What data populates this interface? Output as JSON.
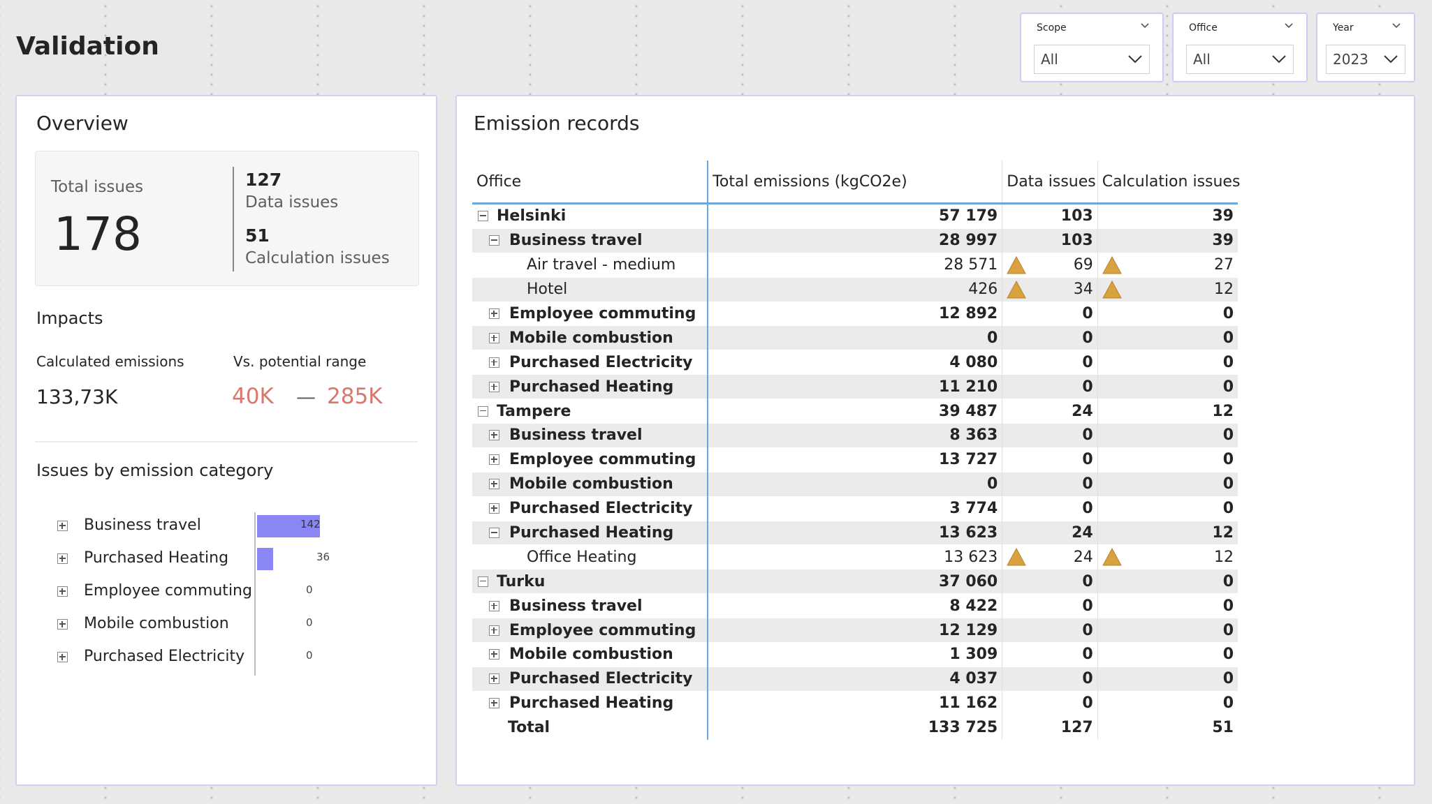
{
  "page": {
    "title": "Validation"
  },
  "slicers": [
    {
      "label": "Scope",
      "value": "All"
    },
    {
      "label": "Office",
      "value": "All"
    },
    {
      "label": "Year",
      "value": "2023"
    }
  ],
  "overview": {
    "title": "Overview",
    "total_issues_label": "Total issues",
    "total_issues": "178",
    "data_issues_value": "127",
    "data_issues_label": "Data issues",
    "calc_issues_value": "51",
    "calc_issues_label": "Calculation issues",
    "impacts_title": "Impacts",
    "calc_emissions_label": "Calculated emissions",
    "calc_emissions_value": "133,73K",
    "range_label": "Vs. potential range",
    "range_low": "40K",
    "range_dash": "—",
    "range_high": "285K",
    "issues_title": "Issues by emission category",
    "bar_color": "#8a87f5",
    "range_color": "#d9776d"
  },
  "chart_data": {
    "type": "bar",
    "orientation": "horizontal",
    "categories": [
      "Business travel",
      "Purchased Heating",
      "Employee commuting",
      "Mobile combustion",
      "Purchased Electricity"
    ],
    "values": [
      142,
      36,
      0,
      0,
      0
    ],
    "value_labels": [
      "142",
      "36",
      "0",
      "0",
      "0"
    ],
    "title": "Issues by emission category",
    "xlim": [
      0,
      142
    ]
  },
  "records": {
    "title": "Emission records",
    "columns": {
      "office": "Office",
      "emissions": "Total emissions (kgCO2e)",
      "data": "Data issues",
      "calc": "Calculation issues"
    },
    "warn_color": "#d9a13f",
    "rows": [
      {
        "level": 0,
        "expander": "minus",
        "name": "Helsinki",
        "emissions": "57 179",
        "data": "103",
        "calc": "39",
        "warn": false,
        "bold": true,
        "zebra": false
      },
      {
        "level": 1,
        "expander": "minus",
        "name": "Business travel",
        "emissions": "28 997",
        "data": "103",
        "calc": "39",
        "warn": false,
        "bold": true,
        "zebra": true
      },
      {
        "level": 2,
        "expander": "",
        "name": "Air travel - medium",
        "emissions": "28 571",
        "data": "69",
        "calc": "27",
        "warn": true,
        "bold": false,
        "zebra": false
      },
      {
        "level": 2,
        "expander": "",
        "name": "Hotel",
        "emissions": "426",
        "data": "34",
        "calc": "12",
        "warn": true,
        "bold": false,
        "zebra": true
      },
      {
        "level": 1,
        "expander": "plus",
        "name": "Employee commuting",
        "emissions": "12 892",
        "data": "0",
        "calc": "0",
        "warn": false,
        "bold": true,
        "zebra": false
      },
      {
        "level": 1,
        "expander": "plus",
        "name": "Mobile combustion",
        "emissions": "0",
        "data": "0",
        "calc": "0",
        "warn": false,
        "bold": true,
        "zebra": true
      },
      {
        "level": 1,
        "expander": "plus",
        "name": "Purchased Electricity",
        "emissions": "4 080",
        "data": "0",
        "calc": "0",
        "warn": false,
        "bold": true,
        "zebra": false
      },
      {
        "level": 1,
        "expander": "plus",
        "name": "Purchased Heating",
        "emissions": "11 210",
        "data": "0",
        "calc": "0",
        "warn": false,
        "bold": true,
        "zebra": true
      },
      {
        "level": 0,
        "expander": "minus",
        "name": "Tampere",
        "emissions": "39 487",
        "data": "24",
        "calc": "12",
        "warn": false,
        "bold": true,
        "zebra": false
      },
      {
        "level": 1,
        "expander": "plus",
        "name": "Business travel",
        "emissions": "8 363",
        "data": "0",
        "calc": "0",
        "warn": false,
        "bold": true,
        "zebra": true
      },
      {
        "level": 1,
        "expander": "plus",
        "name": "Employee commuting",
        "emissions": "13 727",
        "data": "0",
        "calc": "0",
        "warn": false,
        "bold": true,
        "zebra": false
      },
      {
        "level": 1,
        "expander": "plus",
        "name": "Mobile combustion",
        "emissions": "0",
        "data": "0",
        "calc": "0",
        "warn": false,
        "bold": true,
        "zebra": true
      },
      {
        "level": 1,
        "expander": "plus",
        "name": "Purchased Electricity",
        "emissions": "3 774",
        "data": "0",
        "calc": "0",
        "warn": false,
        "bold": true,
        "zebra": false
      },
      {
        "level": 1,
        "expander": "minus",
        "name": "Purchased Heating",
        "emissions": "13 623",
        "data": "24",
        "calc": "12",
        "warn": false,
        "bold": true,
        "zebra": true
      },
      {
        "level": 2,
        "expander": "",
        "name": "Office Heating",
        "emissions": "13 623",
        "data": "24",
        "calc": "12",
        "warn": true,
        "bold": false,
        "zebra": false
      },
      {
        "level": 0,
        "expander": "minus",
        "name": "Turku",
        "emissions": "37 060",
        "data": "0",
        "calc": "0",
        "warn": false,
        "bold": true,
        "zebra": true
      },
      {
        "level": 1,
        "expander": "plus",
        "name": "Business travel",
        "emissions": "8 422",
        "data": "0",
        "calc": "0",
        "warn": false,
        "bold": true,
        "zebra": false
      },
      {
        "level": 1,
        "expander": "plus",
        "name": "Employee commuting",
        "emissions": "12 129",
        "data": "0",
        "calc": "0",
        "warn": false,
        "bold": true,
        "zebra": true
      },
      {
        "level": 1,
        "expander": "plus",
        "name": "Mobile combustion",
        "emissions": "1 309",
        "data": "0",
        "calc": "0",
        "warn": false,
        "bold": true,
        "zebra": false
      },
      {
        "level": 1,
        "expander": "plus",
        "name": "Purchased Electricity",
        "emissions": "4 037",
        "data": "0",
        "calc": "0",
        "warn": false,
        "bold": true,
        "zebra": true
      },
      {
        "level": 1,
        "expander": "plus",
        "name": "Purchased Heating",
        "emissions": "11 162",
        "data": "0",
        "calc": "0",
        "warn": false,
        "bold": true,
        "zebra": false
      }
    ],
    "total": {
      "name": "Total",
      "emissions": "133 725",
      "data": "127",
      "calc": "51"
    }
  }
}
